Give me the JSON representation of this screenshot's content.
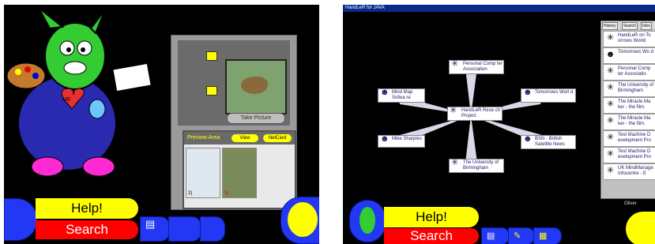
{
  "left_app": {
    "camera": {
      "take_picture": "Take Picture"
    },
    "preview": {
      "title": "Preview Area",
      "view": "View",
      "netcard": "NetCard",
      "thumb1_num": "2)",
      "thumb2_num": "3)"
    },
    "bottom": {
      "help": "Help!",
      "search": "Search"
    }
  },
  "right_app": {
    "window_title": "HandLeR for JAVA",
    "tabs": [
      "History",
      "Search",
      "Inbo"
    ],
    "map_nodes": [
      {
        "label": "HandLeR Rese ch Project"
      },
      {
        "label": "Personal Comp ter Association"
      },
      {
        "label": "Mind Map Sofwa re"
      },
      {
        "label": "Tomorrows Worl d"
      },
      {
        "label": "Mike Sharples"
      },
      {
        "label": "BSN - British Satellite News"
      },
      {
        "label": "The University of Birmingham"
      }
    ],
    "history": [
      "HandLeR on To orrows World",
      "Tomorrows Wo d",
      "Personal Comp ter Associatio",
      "The University of Birmingham",
      "The Miracle Ma ker - the film.",
      "The Miracle Ma ker - the film.",
      "Test Machine D evelopment Pro",
      "Test Machine D evelopment Pro",
      "UK MindManage Infocentre - E"
    ],
    "user": "Oliver",
    "bottom": {
      "help": "Help!",
      "search": "Search"
    }
  },
  "colors": {
    "help_yellow": "#ffff00",
    "search_red": "#ff0000",
    "button_blue": "#2238f5",
    "node_border": "#888888"
  }
}
